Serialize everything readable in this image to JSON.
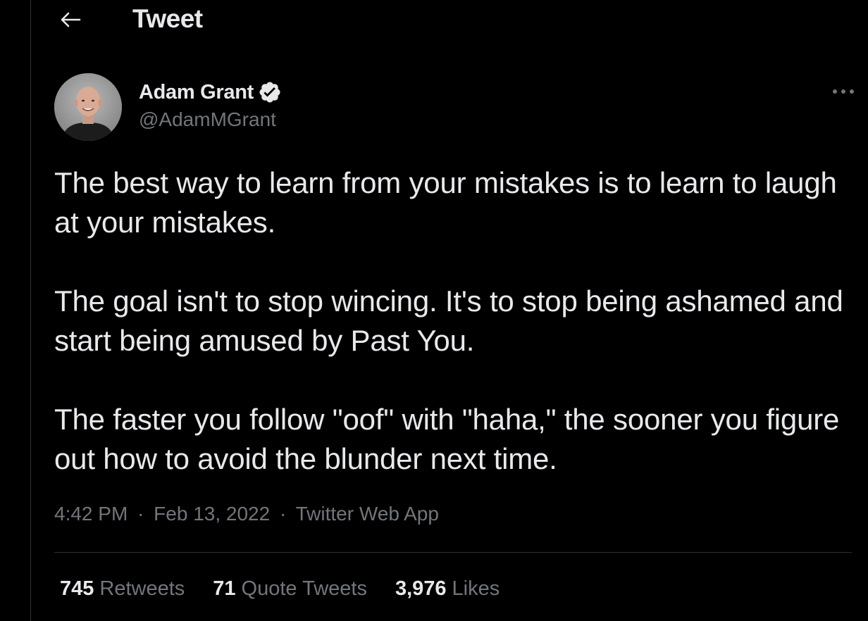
{
  "header": {
    "back_icon": "arrow-left-icon",
    "title": "Tweet"
  },
  "author": {
    "display_name": "Adam Grant",
    "verified_icon": "verified-badge-icon",
    "handle": "@AdamMGrant",
    "more_icon": "more-horizontal-icon"
  },
  "tweet": {
    "paragraphs": [
      "The best way to learn from your mistakes is to learn to laugh at your mistakes.",
      "The goal isn't to stop wincing. It's to stop being ashamed and start being amused by Past You.",
      "The faster you follow \"oof\" with \"haha,\" the sooner you figure out how to avoid the blunder next time."
    ],
    "time": "4:42 PM",
    "separator": "·",
    "date": "Feb 13, 2022",
    "source": "Twitter Web App"
  },
  "stats": {
    "retweets_count": "745",
    "retweets_label": "Retweets",
    "quotes_count": "71",
    "quotes_label": "Quote Tweets",
    "likes_count": "3,976",
    "likes_label": "Likes"
  },
  "colors": {
    "background": "#000000",
    "text_primary": "#e7e9ea",
    "text_secondary": "#71767b",
    "border": "#2f3336",
    "verified": "#e7e9ea"
  }
}
